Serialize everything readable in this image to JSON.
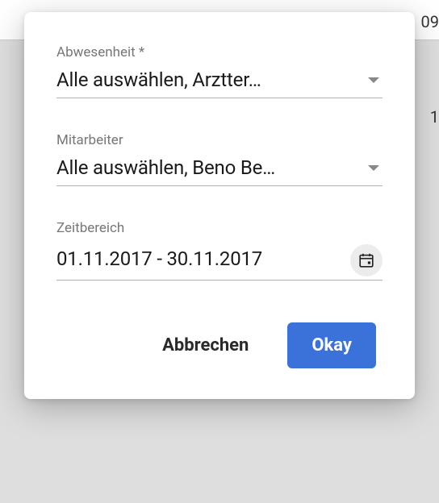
{
  "background": {
    "partialTop": "09",
    "partialMid": "1"
  },
  "dialog": {
    "fields": {
      "absence": {
        "label": "Abwesenheit *",
        "value": "Alle auswählen, Arztter…"
      },
      "employee": {
        "label": "Mitarbeiter",
        "value": "Alle auswählen, Beno Be…"
      },
      "dateRange": {
        "label": "Zeitbereich",
        "value": "01.11.2017 - 30.11.2017"
      }
    },
    "actions": {
      "cancel": "Abbrechen",
      "ok": "Okay"
    }
  }
}
